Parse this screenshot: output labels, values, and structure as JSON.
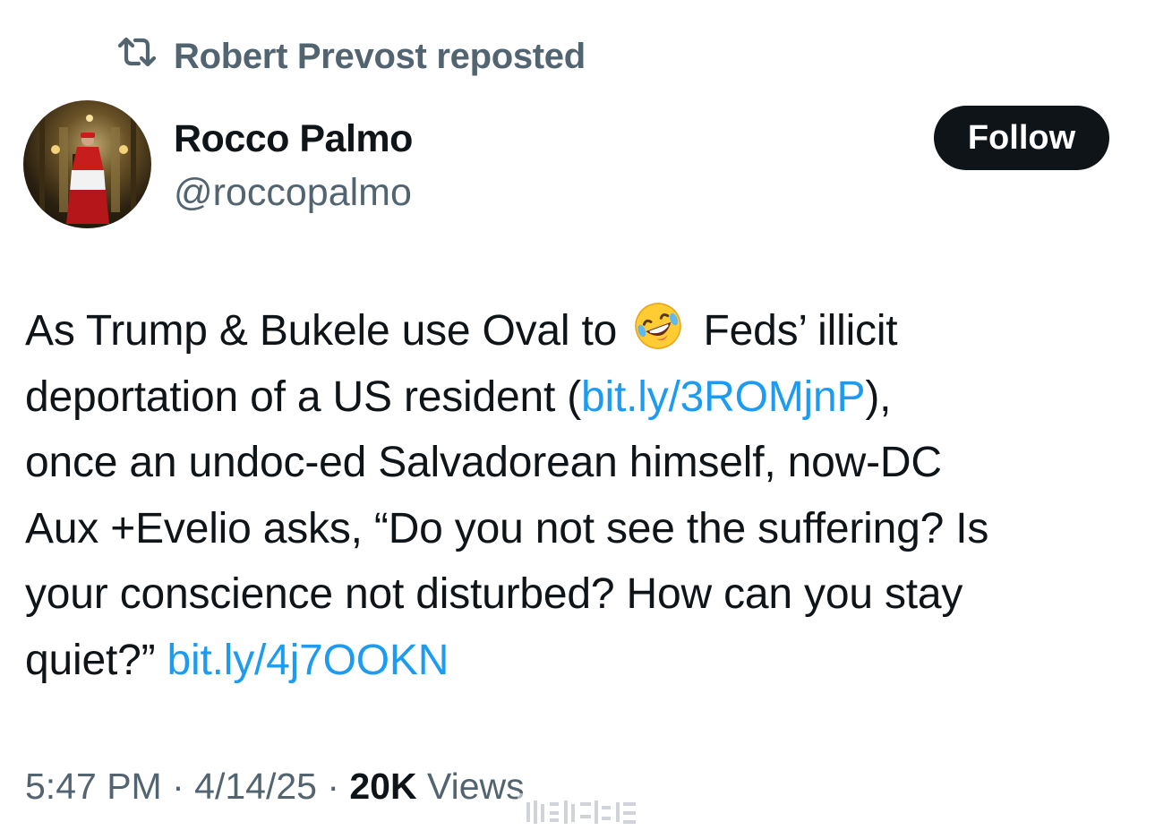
{
  "repost": {
    "label": "Robert Prevost reposted",
    "icon": "repost-icon"
  },
  "author": {
    "name": "Rocco Palmo",
    "handle": "@roccopalmo",
    "avatar_icon": "avatar-image"
  },
  "follow_button": {
    "label": "Follow"
  },
  "tweet": {
    "line1_before_emoji": "As Trump & Bukele use Oval to",
    "emoji": "rolling-on-floor-laughing-emoji",
    "line1_after_emoji": "Feds’ illicit",
    "line2_before_link": "deportation of a US resident (",
    "link1": "bit.ly/3ROMjnP",
    "line2_after_link": "),",
    "line3": "once an undoc-ed Salvadorean himself, now-DC",
    "line4": "Aux +Evelio asks, “Do you not see the suffering? Is",
    "line5": "your conscience not disturbed? How can you stay",
    "line6_before_link": "quiet?” ",
    "link2": "bit.ly/4j7OOKN"
  },
  "meta": {
    "time": "5:47 PM",
    "separator": " · ",
    "date": "4/14/25",
    "views_count": "20K",
    "views_label": " Views"
  },
  "colors": {
    "text_primary": "#0f1419",
    "text_secondary": "#536471",
    "link": "#1d9bf0",
    "button_bg": "#0f1419",
    "button_text": "#ffffff"
  }
}
